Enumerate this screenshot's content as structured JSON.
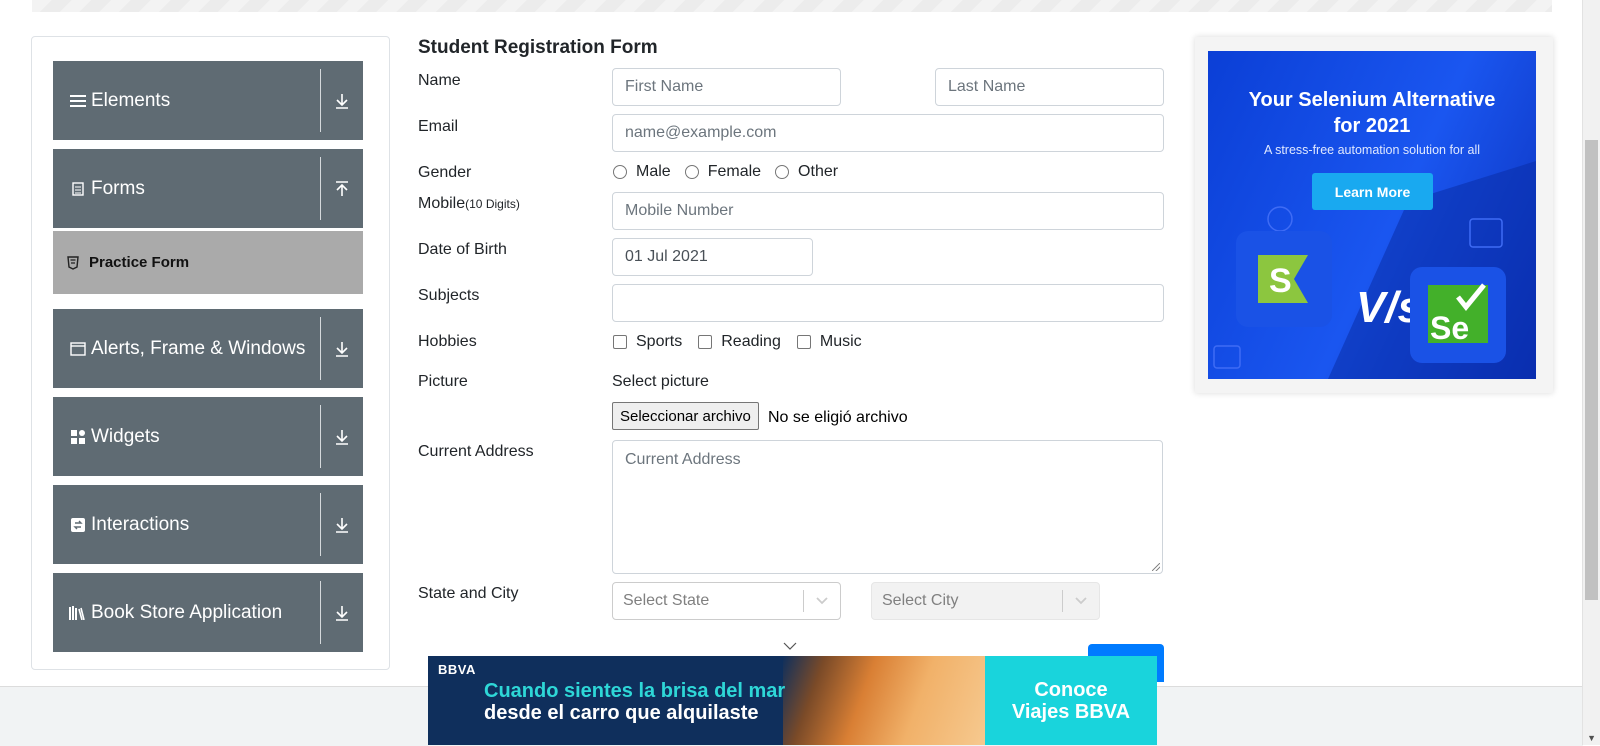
{
  "sidebar": {
    "groups": [
      {
        "label": "Elements",
        "icon": "menu-icon",
        "arrow": "expand-arrow"
      },
      {
        "label": "Forms",
        "icon": "document-icon",
        "arrow": "collapse-arrow"
      },
      {
        "label": "Alerts, Frame & Windows",
        "icon": "window-icon",
        "arrow": "expand-arrow"
      },
      {
        "label": "Widgets",
        "icon": "widgets-icon",
        "arrow": "expand-arrow"
      },
      {
        "label": "Interactions",
        "icon": "interactions-icon",
        "arrow": "expand-arrow"
      },
      {
        "label": "Book Store Application",
        "icon": "books-icon",
        "arrow": "expand-arrow"
      }
    ],
    "active_item": "Practice Form"
  },
  "form": {
    "title": "Student Registration Form",
    "name_label": "Name",
    "first_name_placeholder": "First Name",
    "last_name_placeholder": "Last Name",
    "email_label": "Email",
    "email_placeholder": "name@example.com",
    "gender_label": "Gender",
    "gender_options": [
      "Male",
      "Female",
      "Other"
    ],
    "mobile_label": "Mobile",
    "mobile_hint": "(10 Digits)",
    "mobile_placeholder": "Mobile Number",
    "dob_label": "Date of Birth",
    "dob_value": "01 Jul 2021",
    "subjects_label": "Subjects",
    "hobbies_label": "Hobbies",
    "hobby_options": [
      "Sports",
      "Reading",
      "Music"
    ],
    "picture_label": "Picture",
    "picture_sublabel": "Select picture",
    "file_button": "Seleccionar archivo",
    "file_status": "No se eligió archivo",
    "address_label": "Current Address",
    "address_placeholder": "Current Address",
    "state_city_label": "State and City",
    "state_placeholder": "Select State",
    "city_placeholder": "Select City"
  },
  "right_ad": {
    "title_line1": "Your Selenium Alternative",
    "title_line2": "for 2021",
    "subtitle": "A stress-free automation solution for all",
    "button": "Learn More",
    "vs": "V/s",
    "logo_left": "S",
    "logo_right": "Se"
  },
  "bottom_ad": {
    "brand": "BBVA",
    "line1": "Cuando sientes la brisa del mar",
    "line2": "desde el carro que alquilaste",
    "cta_line1": "Conoce",
    "cta_line2": "Viajes BBVA"
  },
  "colors": {
    "sidebar_header": "#5f6b73",
    "sidebar_active": "#aaaaaa",
    "primary": "#007bff",
    "ad_blue": "#1a56f0",
    "ad_cta": "#19d4dc"
  }
}
